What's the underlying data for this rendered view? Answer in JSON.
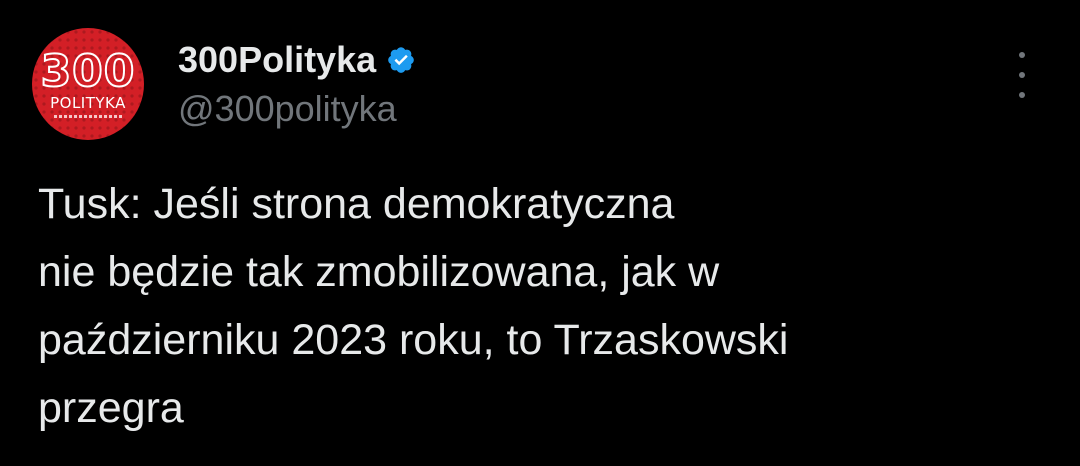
{
  "author": {
    "display_name": "300Polityka",
    "handle": "@300polityka",
    "verified": true,
    "avatar": {
      "number": "300",
      "word": "POLITYKA",
      "background": "#d31f26"
    }
  },
  "tweet": {
    "lines": [
      "Tusk: Jeśli strona demokratyczna",
      "nie będzie tak zmobilizowana, jak w",
      "październiku 2023 roku, to Trzaskowski",
      "przegra"
    ]
  },
  "icons": {
    "verified": "verified-badge-icon",
    "more": "more-options-icon"
  },
  "colors": {
    "background": "#000000",
    "text": "#e7e9ea",
    "secondary_text": "#71767b",
    "verified_blue": "#1d9bf0",
    "avatar_red": "#d31f26"
  }
}
